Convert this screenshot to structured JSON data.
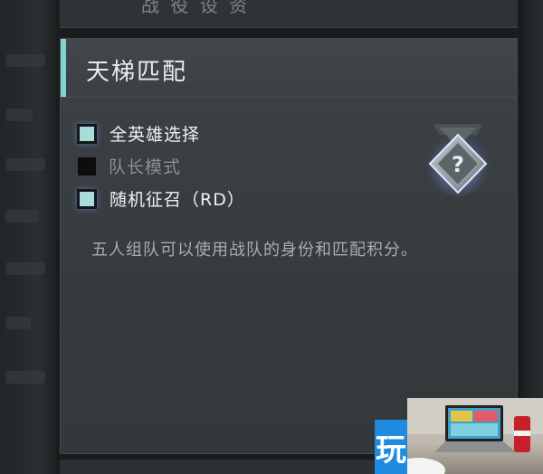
{
  "top_panel": {
    "ghost_text": "战 役 设 资"
  },
  "panel": {
    "title": "天梯匹配",
    "options": [
      {
        "label": "全英雄选择",
        "checked": true,
        "enabled": true
      },
      {
        "label": "队长模式",
        "checked": false,
        "enabled": false
      },
      {
        "label": "随机征召（RD）",
        "checked": true,
        "enabled": true
      }
    ],
    "description": "五人组队可以使用战队的身份和匹配积分。",
    "badge_icon": "rank-unknown-icon",
    "badge_symbol": "?"
  },
  "ad": {
    "logo_text": "玩",
    "logo_color": "#1f8be0"
  },
  "colors": {
    "accent": "#7fd3d0",
    "checkbox_on": "#a8dcda",
    "panel_bg": "#353a3c"
  }
}
